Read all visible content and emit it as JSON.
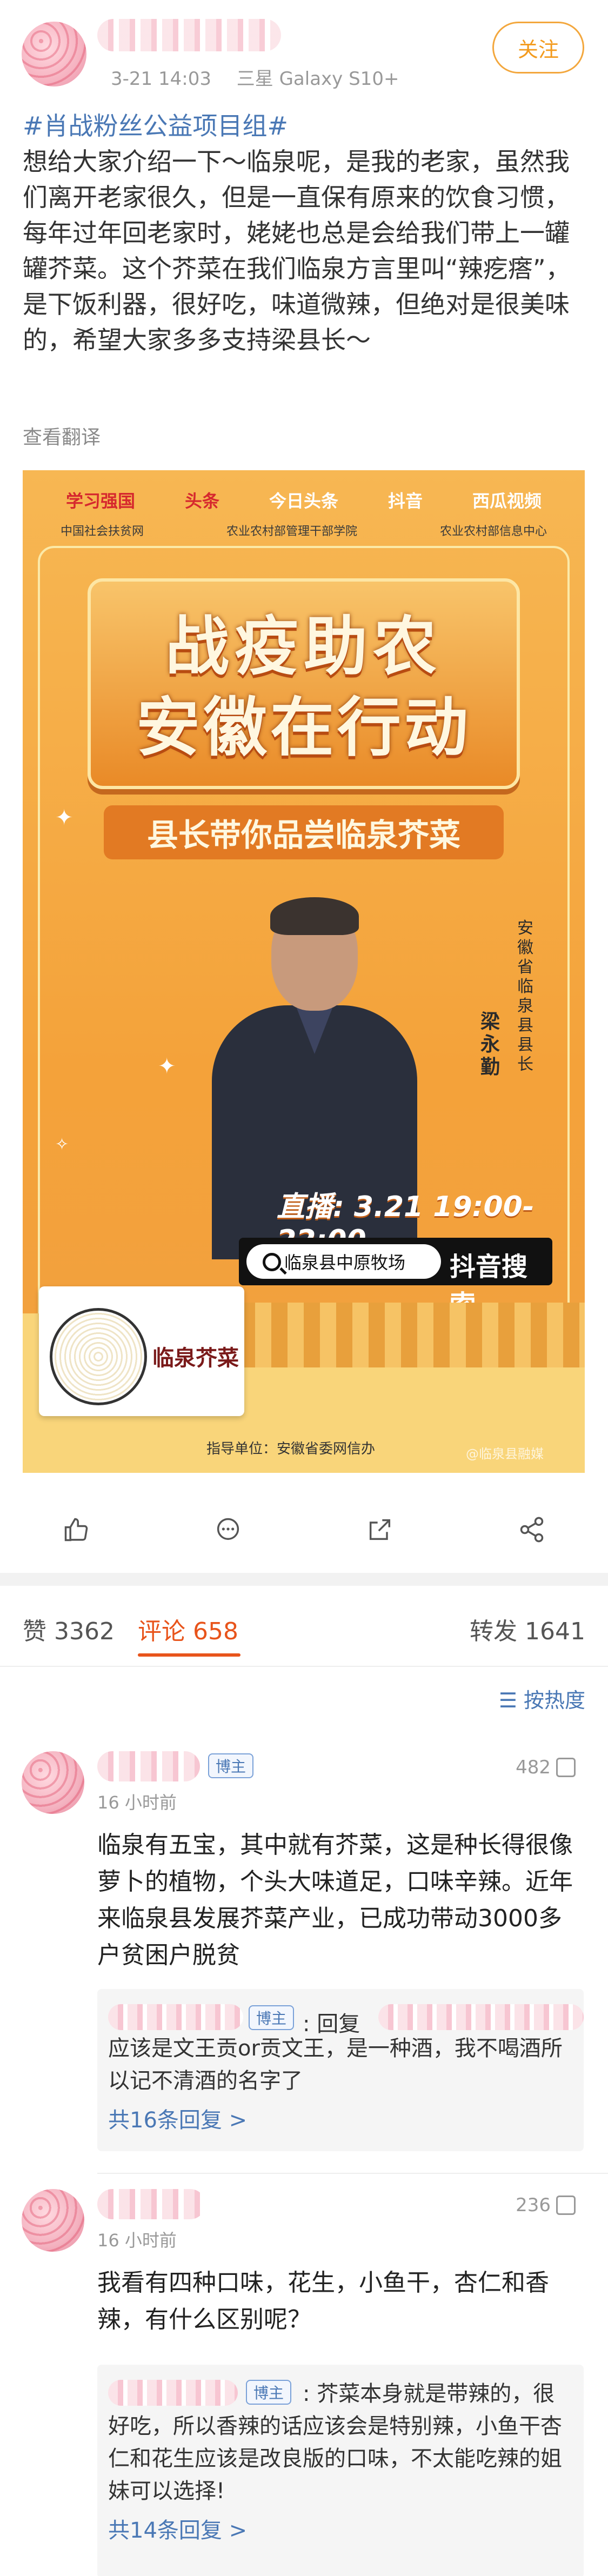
{
  "post": {
    "time": "3-21 14:03",
    "device": "三星 Galaxy S10+",
    "follow_label": "关注",
    "topic": "#肖战粉丝公益项目组#",
    "text": "想给大家介绍一下～临泉呢，是我的老家，虽然我们离开老家很久，但是一直保有原来的饮食习惯，每年过年回老家时，姥姥也总是会给我们带上一罐罐芥菜。这个芥菜在我们临泉方言里叫“辣疙瘩”，是下饭利器，很好吃，味道微辣，但绝对是很美味的，希望大家多多支持梁县长～",
    "translate_label": "查看翻译"
  },
  "poster": {
    "logos": [
      "学习强国",
      "头条",
      "今日头条",
      "抖音",
      "西瓜视频"
    ],
    "orgs": [
      "中国社会扶贫网",
      "农业农村部管理干部学院",
      "农业农村部信息中心"
    ],
    "title_line1": "战疫助农",
    "title_line2": "安徽在行动",
    "subtitle": "县长带你品尝临泉芥菜",
    "side_text": "安徽省临泉县县长",
    "person_name": "梁永勤",
    "live_time": "直播: 3.21  19:00-22:00",
    "search_text": "临泉县中原牧场",
    "search_label": "抖音搜索",
    "product_brand": "临泉芥菜",
    "guide_text": "指导单位：安徽省委网信办",
    "watermark": "@临泉县融媒"
  },
  "actions": [
    {
      "icon": "like-icon"
    },
    {
      "icon": "comment-icon"
    },
    {
      "icon": "share-icon"
    },
    {
      "icon": "more-share-icon"
    }
  ],
  "tabs": {
    "likes": "赞 3362",
    "comments": "评论 658",
    "reposts": "转发 1641"
  },
  "sort_label": "按热度",
  "comments": [
    {
      "badge": "博主",
      "time": "16 小时前",
      "likes": "482",
      "text": "临泉有五宝，其中就有芥菜，这是种长得很像萝卜的植物，个头大味道足，口味辛辣。近年来临泉县发展芥菜产业，已成功带动3000多户贫困户脱贫",
      "reply_badge": "博主",
      "reply_prefix": ": 回复",
      "reply_text": "应该是文王贡or贡文王，是一种酒，我不喝酒所以记不清酒的名字了",
      "reply_more": "共16条回复 >"
    },
    {
      "time": "16 小时前",
      "likes": "236",
      "text": "我看有四种口味，花生，小鱼干，杏仁和香辣，有什么区别呢？",
      "reply_badge": "博主",
      "reply_text": ": 芥菜本身就是带辣的，很好吃，所以香辣的话应该会是特别辣，小鱼干杏仁和花生应该是改良版的口味，不太能吃辣的姐妹可以选择!",
      "reply_more": "共14条回复 >"
    }
  ],
  "colors": {
    "accent": "#e8541b",
    "link": "#4a78b5",
    "follow": "#f39b1e",
    "poster_bg": "#f4a43e"
  }
}
